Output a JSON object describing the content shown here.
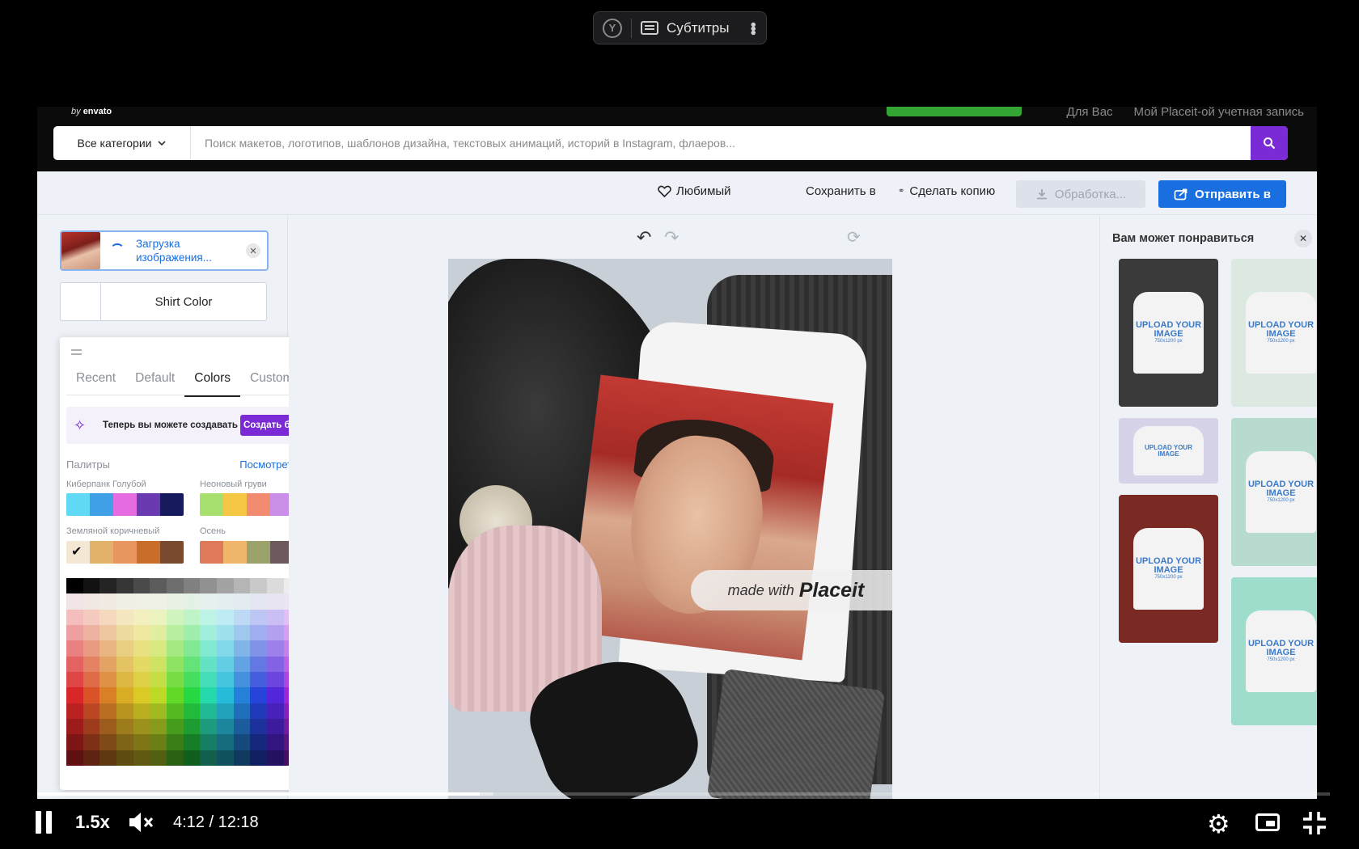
{
  "overlay": {
    "subtitles_label": "Субтитры",
    "yandex_icon": "yandex-icon",
    "cc_icon": "subtitles-icon",
    "more_icon": "more-vertical-icon"
  },
  "site": {
    "logo_by": "by",
    "logo_name": "envato",
    "nav": [
      "Для Вас",
      "Мой Placeit-ой учетная запись"
    ],
    "category_select": "Все категории",
    "search_placeholder": "Поиск макетов, логотипов, шаблонов дизайна, текстовых анимаций, историй в Instagram, флаеров...",
    "search_icon": "search-icon"
  },
  "toolbar": {
    "favorite": "Любимый",
    "save_to": "Сохранить в",
    "copy": "Сделать копию",
    "processing": "Обработка...",
    "send": "Отправить в"
  },
  "left": {
    "upload_status": "Загрузка изображения...",
    "shirt_color": "Shirt Color",
    "tabs": [
      "Recent",
      "Default",
      "Colors",
      "Custom"
    ],
    "active_tab": "Colors",
    "brand_text": "Теперь вы можете создавать бр",
    "brand_button": "Создать бренд",
    "palettes_title": "Палитры",
    "see_all": "Посмотреть все",
    "palettes": [
      {
        "name": "Киберпанк Голубой",
        "colors": [
          "#5fd9f5",
          "#3fa0e8",
          "#e46be0",
          "#6a3bb0",
          "#171a5c"
        ]
      },
      {
        "name": "Неоновый груви",
        "colors": [
          "#a8e070",
          "#f6c645",
          "#f28b6f",
          "#c98ee8",
          "#0d0d0d"
        ]
      },
      {
        "name": "Земляной коричневый",
        "colors": [
          "#f4e7d4",
          "#e3b26a",
          "#e89560",
          "#c96d2a",
          "#7a4a2e"
        ]
      },
      {
        "name": "Осень",
        "colors": [
          "#de7a5a",
          "#efb56a",
          "#9ca36a",
          "#6d5a5c",
          "#4a3a3c"
        ]
      }
    ]
  },
  "editor": {
    "watermark_small": "made with",
    "watermark_brand": "Placeit"
  },
  "right": {
    "title": "Вам может понравиться",
    "card_text": "UPLOAD YOUR IMAGE",
    "card_size": "750x1200 px"
  },
  "player": {
    "speed": "1.5x",
    "time": "4:12 / 12:18",
    "progress": 0.342
  }
}
